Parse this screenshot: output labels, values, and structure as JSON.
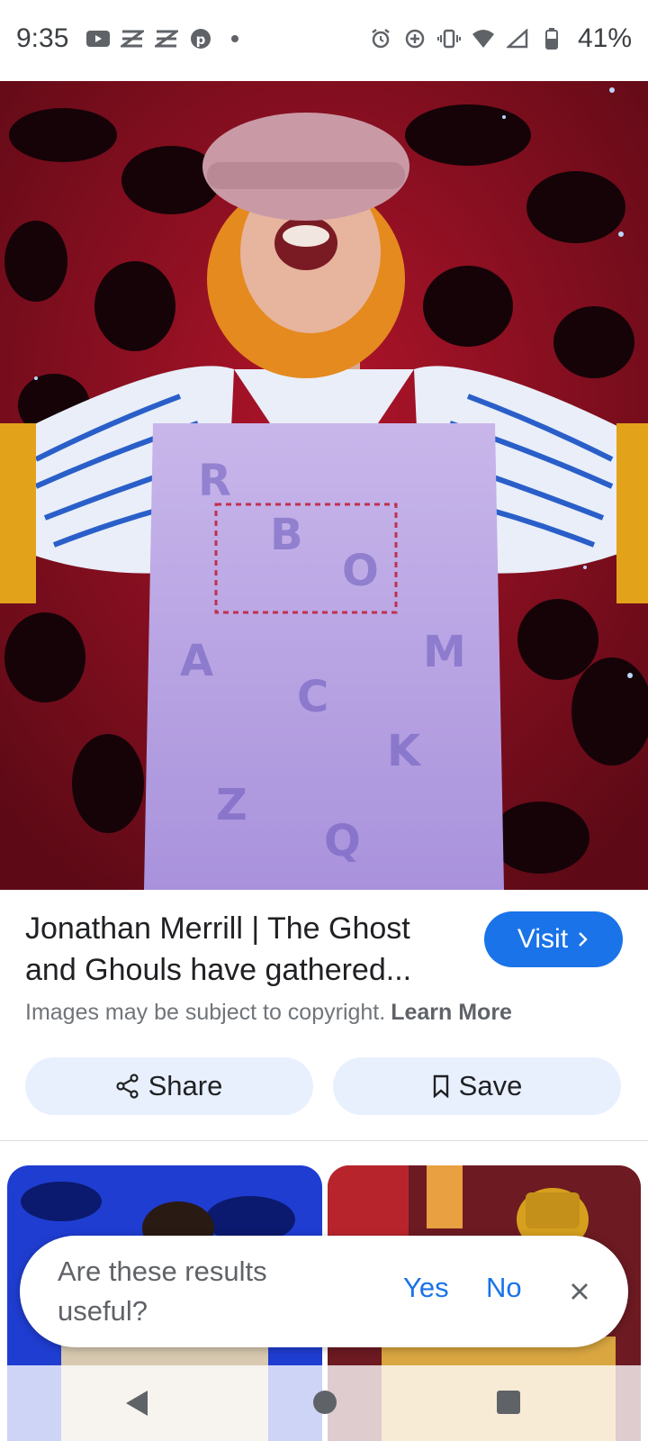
{
  "status_bar": {
    "time": "9:35",
    "battery": "41%",
    "left_icons": [
      "youtube-icon",
      "notification-icon",
      "notification-icon",
      "pinterest-icon",
      "dot-icon"
    ],
    "right_icons": [
      "alarm-icon",
      "data-saver-icon",
      "vibrate-icon",
      "wifi-icon",
      "signal-icon",
      "battery-icon"
    ]
  },
  "result": {
    "title": "Jonathan Merrill | The Ghost and Ghouls have gathered...",
    "visit_label": "Visit",
    "copyright_text": "Images may be subject to copyright.",
    "learn_more": "Learn More",
    "share_label": "Share",
    "save_label": "Save"
  },
  "feedback": {
    "question": "Are these results useful?",
    "yes": "Yes",
    "no": "No"
  },
  "colors": {
    "accent": "#1a73e8",
    "pill_bg": "#e8f0fe"
  }
}
